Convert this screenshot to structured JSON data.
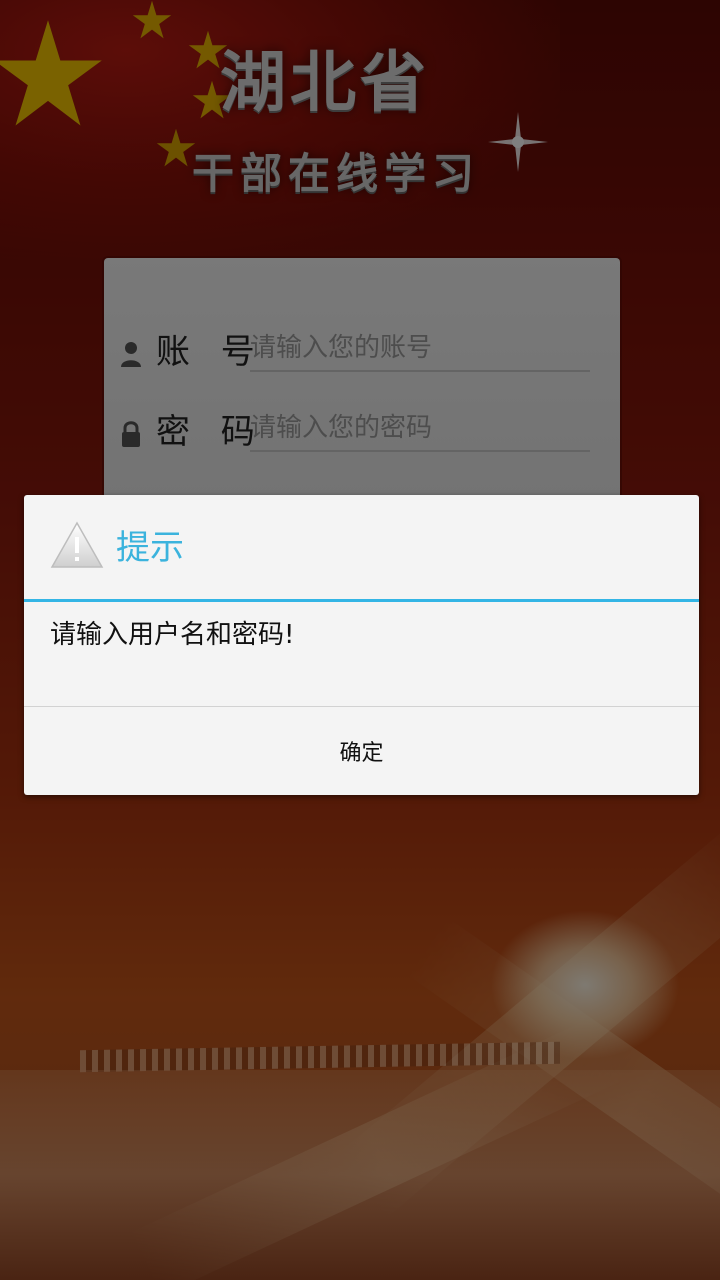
{
  "header": {
    "title_main": "湖北省",
    "title_sub": "干部在线学习"
  },
  "login": {
    "account_label": "账 号",
    "account_placeholder": "请输入您的账号",
    "password_label": "密 码",
    "password_placeholder": "请输入您的密码"
  },
  "dialog": {
    "title": "提示",
    "message": "请输入用户名和密码!",
    "ok_label": "确定"
  },
  "colors": {
    "dialog_accent": "#33b5e5",
    "background": "#8a1a0c"
  },
  "icons": [
    "star-icon",
    "user-icon",
    "lock-icon",
    "warning-icon",
    "sparkle-icon"
  ]
}
